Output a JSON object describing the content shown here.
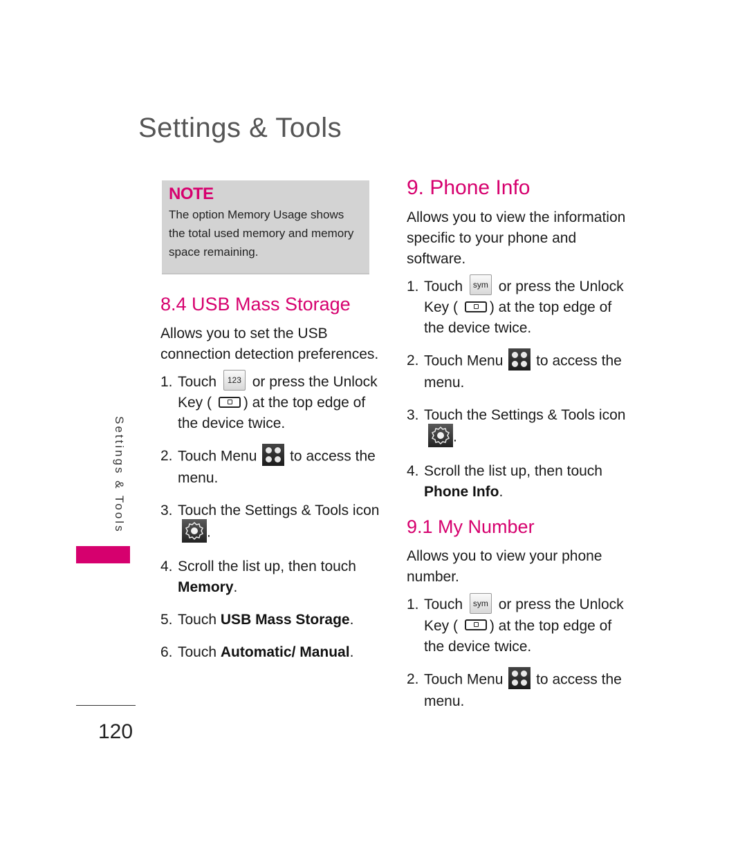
{
  "page_title": "Settings & Tools",
  "side_tab": {
    "label": "Settings & Tools",
    "accent_color": "#d6006e"
  },
  "page_number": "120",
  "note": {
    "label": "NOTE",
    "text": "The option Memory Usage shows the total used memory and memory space remaining."
  },
  "usb": {
    "heading": "8.4 USB Mass Storage",
    "intro": "Allows you to set the USB connection detection preferences.",
    "steps": [
      {
        "num": "1.",
        "pre": "Touch",
        "key": "123",
        "post": "or press the Unlock Key (",
        "post2": ") at the top edge of the device twice."
      },
      {
        "num": "2.",
        "pre": "Touch Menu",
        "post": "to access the menu."
      },
      {
        "num": "3.",
        "pre": "Touch the Settings & Tools icon",
        "post": "."
      },
      {
        "num": "4.",
        "pre": "Scroll the list up, then touch",
        "bold": "Memory",
        "post": "."
      },
      {
        "num": "5.",
        "pre": "Touch",
        "bold": "USB Mass Storage",
        "post": "."
      },
      {
        "num": "6.",
        "pre": "Touch",
        "bold": "Automatic/ Manual",
        "post": "."
      }
    ]
  },
  "phone_info": {
    "heading": "9. Phone Info",
    "intro": "Allows you to view the information specific to your phone and software.",
    "steps": [
      {
        "num": "1.",
        "pre": "Touch",
        "key": "sym",
        "post": "or press the Unlock Key (",
        "post2": ") at the top edge of the device twice."
      },
      {
        "num": "2.",
        "pre": "Touch Menu",
        "post": "to access the menu."
      },
      {
        "num": "3.",
        "pre": "Touch the Settings & Tools icon",
        "post": "."
      },
      {
        "num": "4.",
        "pre": "Scroll the list up, then touch",
        "bold": "Phone Info",
        "post": "."
      }
    ]
  },
  "my_number": {
    "heading": "9.1 My Number",
    "intro": "Allows you to view your phone number.",
    "steps": [
      {
        "num": "1.",
        "pre": "Touch",
        "key": "sym",
        "post": "or press the Unlock Key (",
        "post2": ") at the top edge of the device twice."
      },
      {
        "num": "2.",
        "pre": "Touch Menu",
        "post": "to access the menu."
      }
    ]
  },
  "icons": {
    "unlock_key": "unlock-key-icon",
    "menu": "menu-grid-icon",
    "settings": "settings-gear-icon"
  }
}
